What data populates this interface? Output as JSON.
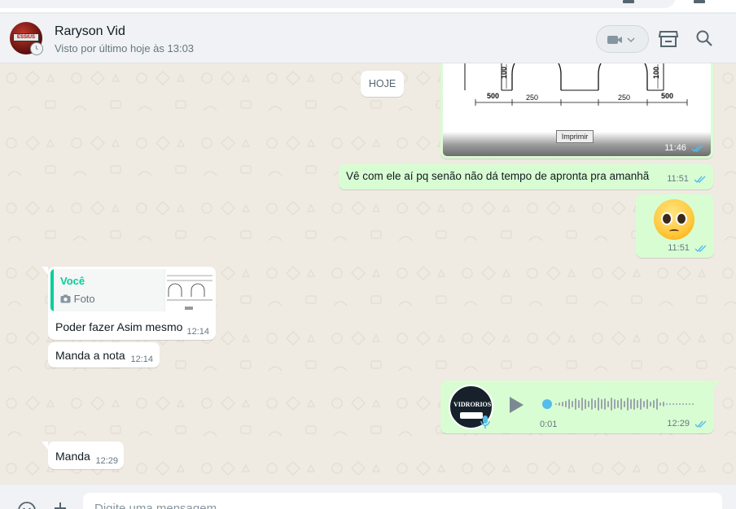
{
  "header": {
    "contact_name": "Raryson Vid",
    "contact_status": "Visto por último hoje às 13:03",
    "avatar_text": "ESSIUS"
  },
  "chat": {
    "date_chip": "HOJE",
    "messages": [
      {
        "type": "image",
        "direction": "out",
        "time": "11:46",
        "status": "read",
        "drawing_labels": [
          "100",
          "500",
          "250",
          "250",
          "100",
          "500"
        ],
        "print_button": "Imprimir"
      },
      {
        "type": "text",
        "direction": "out",
        "text": "Vê com ele aí pq senão não dá tempo de apronta pra amanhã",
        "time": "11:51",
        "status": "read"
      },
      {
        "type": "emoji",
        "direction": "out",
        "emoji_name": "pleading-face",
        "time": "11:51",
        "status": "read"
      },
      {
        "type": "reply",
        "direction": "in",
        "quote_author": "Você",
        "quote_type": "Foto",
        "text": "Poder fazer Asim mesmo",
        "time": "12:14"
      },
      {
        "type": "text",
        "direction": "in",
        "text": "Manda a nota",
        "time": "12:14"
      },
      {
        "type": "voice",
        "direction": "out",
        "avatar_text": "VIDRORIOS",
        "duration": "0:01",
        "time": "12:29",
        "status": "read"
      },
      {
        "type": "text",
        "direction": "in",
        "text": "Manda",
        "time": "12:29"
      }
    ]
  },
  "composer": {
    "placeholder": "Digite uma mensagem"
  },
  "colors": {
    "outgoing_bubble": "#d9fdd3",
    "incoming_bubble": "#ffffff",
    "read_ticks": "#53bdeb",
    "accent": "#06cf9c"
  }
}
